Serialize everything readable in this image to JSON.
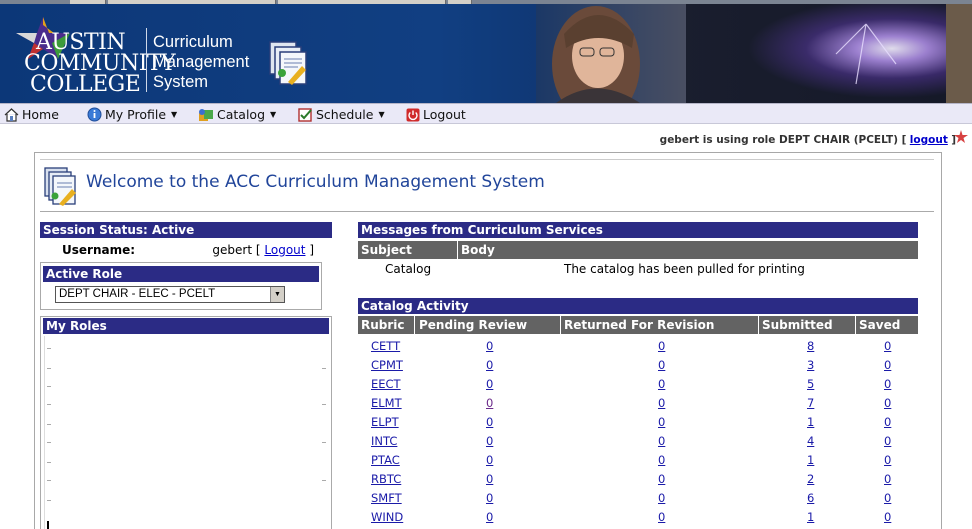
{
  "banner": {
    "logo_lines": [
      "AUSTIN",
      "COMMUNITY",
      "COLLEGE"
    ],
    "system_lines": [
      "Curriculum",
      "Management",
      "System"
    ]
  },
  "nav": {
    "items": [
      {
        "label": "Home",
        "icon": "house-icon",
        "dropdown": false
      },
      {
        "label": "My Profile",
        "icon": "info-icon",
        "dropdown": true
      },
      {
        "label": "Catalog",
        "icon": "catalog-icon",
        "dropdown": true
      },
      {
        "label": "Schedule",
        "icon": "checkbox-icon",
        "dropdown": true
      },
      {
        "label": "Logout",
        "icon": "power-icon",
        "dropdown": false
      }
    ]
  },
  "role_line": {
    "prefix": "gebert is using role DEPT CHAIR (PCELT) [",
    "link": "logout",
    "suffix": "]"
  },
  "welcome": {
    "title": "Welcome to the ACC Curriculum Management System"
  },
  "session": {
    "header": "Session Status: Active",
    "username_label": "Username:",
    "username": "gebert",
    "logout_prefix": "[",
    "logout_link": "Logout",
    "logout_suffix": "]"
  },
  "active_role": {
    "header": "Active Role",
    "selected": "DEPT CHAIR - ELEC - PCELT"
  },
  "my_roles": {
    "header": "My Roles"
  },
  "messages": {
    "header": "Messages from Curriculum Services",
    "columns": [
      "Subject",
      "Body"
    ],
    "rows": [
      {
        "subject": "Catalog",
        "body": "The catalog has been pulled for printing"
      }
    ]
  },
  "catalog_activity": {
    "header": "Catalog Activity",
    "columns": [
      "Rubric",
      "Pending Review",
      "Returned For Revision",
      "Submitted",
      "Saved"
    ],
    "rows": [
      {
        "rubric": "CETT",
        "pending": "0",
        "returned": "0",
        "submitted": "8",
        "saved": "0"
      },
      {
        "rubric": "CPMT",
        "pending": "0",
        "returned": "0",
        "submitted": "3",
        "saved": "0"
      },
      {
        "rubric": "EECT",
        "pending": "0",
        "returned": "0",
        "submitted": "5",
        "saved": "0"
      },
      {
        "rubric": "ELMT",
        "pending": "0",
        "returned": "0",
        "submitted": "7",
        "saved": "0"
      },
      {
        "rubric": "ELPT",
        "pending": "0",
        "returned": "0",
        "submitted": "1",
        "saved": "0"
      },
      {
        "rubric": "INTC",
        "pending": "0",
        "returned": "0",
        "submitted": "4",
        "saved": "0"
      },
      {
        "rubric": "PTAC",
        "pending": "0",
        "returned": "0",
        "submitted": "1",
        "saved": "0"
      },
      {
        "rubric": "RBTC",
        "pending": "0",
        "returned": "0",
        "submitted": "2",
        "saved": "0"
      },
      {
        "rubric": "SMFT",
        "pending": "0",
        "returned": "0",
        "submitted": "6",
        "saved": "0"
      },
      {
        "rubric": "WIND",
        "pending": "0",
        "returned": "0",
        "submitted": "1",
        "saved": "0"
      }
    ]
  },
  "colors": {
    "header_bar": "#2b2b85",
    "column_bar": "#636363",
    "title_blue": "#21459a",
    "banner_blue": "#0f3a75",
    "nav_bg": "#eae9f7",
    "link": "#1a1aa8"
  }
}
